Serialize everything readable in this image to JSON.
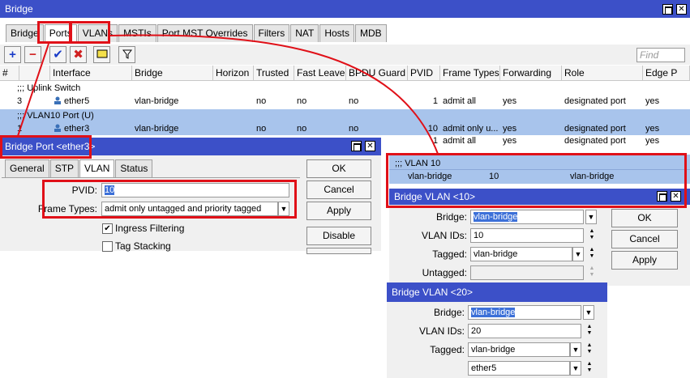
{
  "main_window": {
    "title": "Bridge",
    "tabs": [
      "Bridge",
      "Ports",
      "VLANs",
      "MSTIs",
      "Port MST Overrides",
      "Filters",
      "NAT",
      "Hosts",
      "MDB"
    ],
    "active_tab": "Ports",
    "find_placeholder": "Find",
    "columns": [
      "#",
      "Interface",
      "Bridge",
      "Horizon",
      "Trusted",
      "Fast Leave",
      "BPDU Guard",
      "PVID",
      "Frame Types",
      "Forwarding",
      "Role",
      "Edge P"
    ],
    "groups": [
      {
        "comment": ";;; Uplink Switch",
        "rows": [
          {
            "num": "3",
            "interface": "ether5",
            "bridge": "vlan-bridge",
            "horizon": "",
            "trusted": "no",
            "fast_leave": "no",
            "bpdu_guard": "no",
            "pvid": "1",
            "frame_types": "admit all",
            "forwarding": "yes",
            "role": "designated port",
            "edge": "yes"
          }
        ]
      },
      {
        "comment": ";;; VLAN10 Port (U)",
        "rows": [
          {
            "num": "1",
            "interface": "ether3",
            "bridge": "vlan-bridge",
            "horizon": "",
            "trusted": "no",
            "fast_leave": "no",
            "bpdu_guard": "no",
            "pvid": "10",
            "frame_types": "admit only u...",
            "forwarding": "yes",
            "role": "designated port",
            "edge": "yes"
          },
          {
            "num": "",
            "interface": "",
            "bridge": "",
            "horizon": "",
            "trusted": "",
            "fast_leave": "",
            "bpdu_guard": "",
            "pvid": "1",
            "frame_types": "admit all",
            "forwarding": "yes",
            "role": "designated port",
            "edge": "yes"
          }
        ]
      }
    ]
  },
  "bridge_port_dialog": {
    "title": "Bridge Port <ether3>",
    "tabs": [
      "General",
      "STP",
      "VLAN",
      "Status"
    ],
    "active_tab": "VLAN",
    "pvid_label": "PVID:",
    "pvid_value": "10",
    "frame_types_label": "Frame Types:",
    "frame_types_value": "admit only untagged and priority tagged",
    "ingress_filtering_label": "Ingress Filtering",
    "ingress_filtering_checked": true,
    "tag_stacking_label": "Tag Stacking",
    "tag_stacking_checked": false,
    "buttons": {
      "ok": "OK",
      "cancel": "Cancel",
      "apply": "Apply",
      "disable": "Disable"
    }
  },
  "vlan_list_snippet": {
    "comment": ";;; VLAN 10",
    "bridge": "vlan-bridge",
    "vlan_ids": "10",
    "current_tagged": "vlan-bridge"
  },
  "bridge_vlan_10": {
    "title": "Bridge VLAN <10>",
    "bridge_label": "Bridge:",
    "bridge_value": "vlan-bridge",
    "vlan_ids_label": "VLAN IDs:",
    "vlan_ids_value": "10",
    "tagged_label": "Tagged:",
    "tagged_value": "vlan-bridge",
    "untagged_label": "Untagged:",
    "buttons": {
      "ok": "OK",
      "cancel": "Cancel",
      "apply": "Apply"
    }
  },
  "bridge_vlan_20": {
    "title": "Bridge VLAN <20>",
    "bridge_label": "Bridge:",
    "bridge_value": "vlan-bridge",
    "vlan_ids_label": "VLAN IDs:",
    "vlan_ids_value": "20",
    "tagged_label": "Tagged:",
    "tagged_values": [
      "vlan-bridge",
      "ether5"
    ]
  },
  "colors": {
    "titlebar": "#3c50c8",
    "selected_row": "#a8c4ec",
    "highlight_box": "#e01018",
    "plus_icon": "#1a3cc8",
    "minus_icon": "#d02020",
    "check_icon": "#1a3cc8",
    "x_icon": "#d02020"
  }
}
